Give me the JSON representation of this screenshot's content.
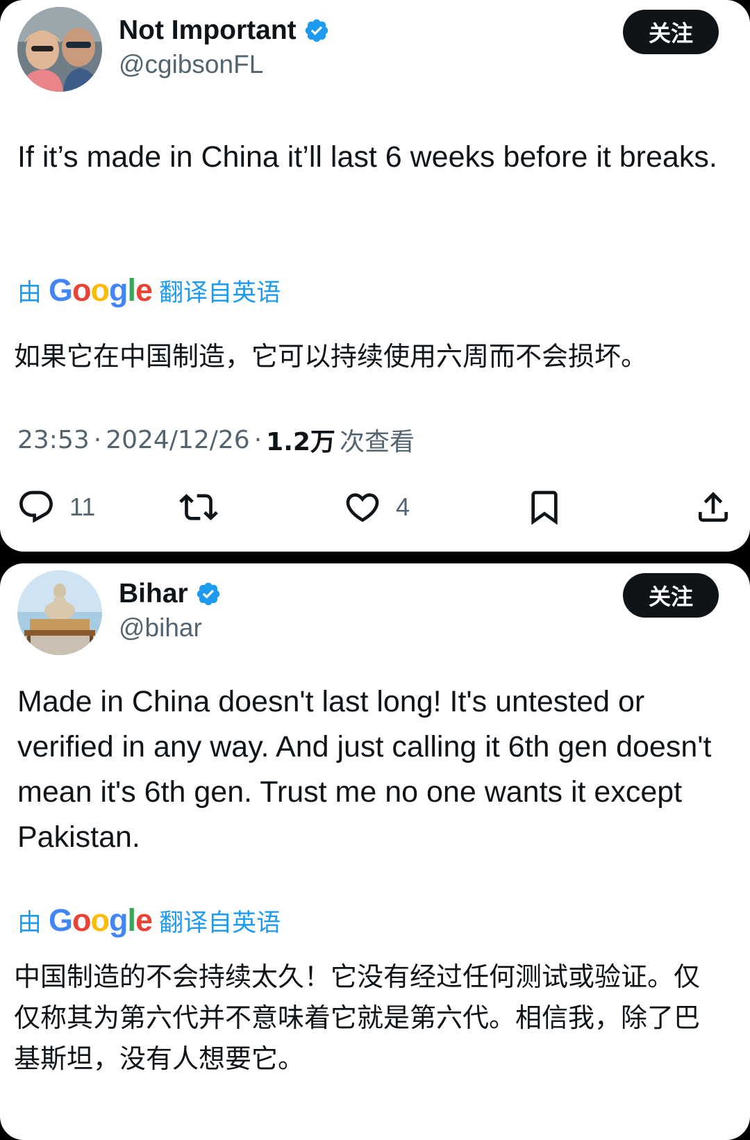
{
  "tweets": [
    {
      "author_name": "Not Important",
      "author_handle": "@cgibsonFL",
      "follow_label": "关注",
      "text": "If it’s made in China it’ll last 6 weeks before it breaks.",
      "translate_prefix": "由",
      "translate_brand": "Google",
      "translate_suffix": "翻译自英语",
      "translated_text": "如果它在中国制造，它可以持续使用六周而不会损坏。",
      "time": "23:53",
      "date": "2024/12/26",
      "views_count": "1.2万",
      "views_label": "次查看",
      "reply_count": "11",
      "like_count": "4"
    },
    {
      "author_name": "Bihar",
      "author_handle": "@bihar",
      "follow_label": "关注",
      "text": "Made in China doesn't last long! It's untested or verified in any way. And just calling it 6th gen doesn't mean it's 6th gen. Trust me no one wants it except Pakistan.",
      "translate_prefix": "由",
      "translate_brand": "Google",
      "translate_suffix": "翻译自英语",
      "translated_text": "中国制造的不会持续太久！它没有经过任何测试或验证。仅仅称其为第六代并不意味着它就是第六代。相信我，除了巴基斯坦，没有人想要它。"
    }
  ],
  "meta_separator": "·",
  "colors": {
    "verified": "#1d9bf0",
    "link_blue": "#1d9bf0",
    "muted": "#536471",
    "text": "#0f1419"
  },
  "icons": [
    "verified-badge-icon",
    "reply-icon",
    "retweet-icon",
    "like-icon",
    "bookmark-icon",
    "share-icon"
  ]
}
